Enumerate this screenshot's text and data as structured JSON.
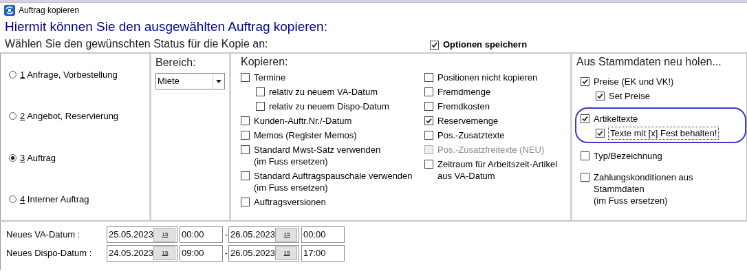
{
  "window": {
    "title": "Auftrag kopieren"
  },
  "heading": "Hiermit können Sie den ausgewählten Auftrag kopieren:",
  "status_prompt": "Wählen Sie den gewünschten Status für die Kopie an:",
  "save_options": {
    "label": "Optionen speichern",
    "checked": true
  },
  "status_options": [
    {
      "key": "1",
      "label": "Anfrage, Vorbestellung",
      "selected": false
    },
    {
      "key": "2",
      "label": "Angebot, Reservierung",
      "selected": false
    },
    {
      "key": "3",
      "label": "Auftrag",
      "selected": true
    },
    {
      "key": "4",
      "label": "Interner Auftrag",
      "selected": false
    }
  ],
  "bereich": {
    "label": "Bereich:",
    "value": "Miete"
  },
  "kopieren": {
    "title": "Kopieren:",
    "column_1": [
      {
        "label": "Termine",
        "checked": false,
        "disabled": false,
        "children": [
          {
            "label": "relativ zu neuem VA-Datum",
            "checked": false,
            "disabled": false
          },
          {
            "label": "relativ zu neuem Dispo-Datum",
            "checked": false,
            "disabled": false
          }
        ]
      },
      {
        "label": "Kunden-Auftr.Nr./-Datum",
        "checked": false,
        "disabled": false
      },
      {
        "label": "Memos (Register Memos)",
        "checked": false,
        "disabled": false
      },
      {
        "label": "Standard Mwst-Satz verwenden\n(im Fuss ersetzen)",
        "checked": false,
        "disabled": false
      },
      {
        "label": "Standard Auftragspauschale verwenden\n(im Fuss ersetzen)",
        "checked": false,
        "disabled": false
      },
      {
        "label": "Auftragsversionen",
        "checked": false,
        "disabled": false
      }
    ],
    "column_2": [
      {
        "label": "Positionen nicht kopieren",
        "checked": false,
        "disabled": false
      },
      {
        "label": "Fremdmenge",
        "checked": false,
        "disabled": false
      },
      {
        "label": "Fremdkosten",
        "checked": false,
        "disabled": false
      },
      {
        "label": "Reservemenge",
        "checked": true,
        "disabled": false
      },
      {
        "label": "Pos.-Zusatztexte",
        "checked": false,
        "disabled": false
      },
      {
        "label": "Pos.-Zusatzfreitexte (NEU)",
        "checked": false,
        "disabled": true
      },
      {
        "label": "Zeitraum für Arbeitszeit-Artikel\naus VA-Datum",
        "checked": false,
        "disabled": false
      }
    ]
  },
  "stammdaten": {
    "title": "Aus Stammdaten neu holen...",
    "items": [
      {
        "label": "Preise (EK und VK!)",
        "checked": true,
        "disabled": false,
        "circled": false,
        "children": [
          {
            "label": "Set Preise",
            "checked": true,
            "disabled": false,
            "focused": false
          }
        ]
      },
      {
        "label": "Artikeltexte",
        "checked": true,
        "disabled": false,
        "circled": true,
        "children": [
          {
            "label": "Texte mit [x] Fest behalten!",
            "checked": true,
            "disabled": false,
            "focused": true
          }
        ]
      },
      {
        "label": "Typ/Bezeichnung",
        "checked": false,
        "disabled": false,
        "circled": false
      },
      {
        "label": "Zahlungskonditionen aus\nStammdaten\n(im Fuss ersetzen)",
        "checked": false,
        "disabled": false,
        "circled": false
      }
    ]
  },
  "dates": [
    {
      "label": "Neues VA-Datum :",
      "from_date": "25.05.2023",
      "from_time": "00:00",
      "separator": "-",
      "to_date": "26.05.2023",
      "to_time": "00:00",
      "from_picker_label": "15",
      "to_picker_label": "15"
    },
    {
      "label": "Neues Dispo-Datum :",
      "from_date": "24.05.2023",
      "from_time": "09:00",
      "separator": "-",
      "to_date": "26.05.2023",
      "to_time": "17:00",
      "from_picker_label": "15",
      "to_picker_label": "15"
    }
  ]
}
